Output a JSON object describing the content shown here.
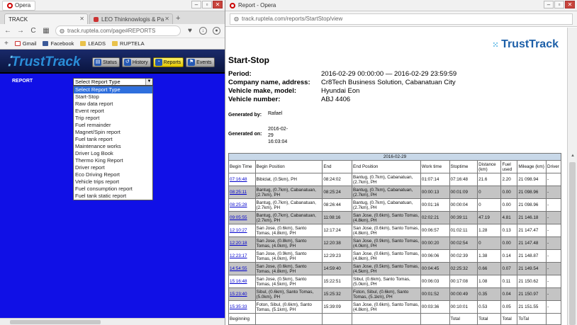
{
  "left": {
    "opera_label": "Opera",
    "tabs": [
      {
        "title": "TRACK"
      },
      {
        "title": "LEO Thinknowlogis & Pa"
      }
    ],
    "url": "track.ruptela.com/page#REPORTS",
    "bookmarks": [
      "Gmail",
      "Facebook",
      "LEADS",
      "RUPTELA"
    ],
    "app_logo": "TrustTrack",
    "nav": [
      "Status",
      "History",
      "Reports",
      "Events"
    ],
    "active_nav": "Reports",
    "report_label": "REPORT",
    "select_value": "Select Report Type",
    "options": [
      "Select Report Type",
      "Start-Stop",
      "Raw data report",
      "Event report",
      "Trip report",
      "Fuel remainder",
      "Magnet/Spin report",
      "Fuel tank report",
      "Maintenance works",
      "Driver Log Book",
      "Thermo King Report",
      "Driver report",
      "Eco Driving Report",
      "Vehicle trips report",
      "Fuel consumption report",
      "Fuel tank static report"
    ]
  },
  "right": {
    "window_title": "Report - Opera",
    "url": "track.ruptela.com/reports/StartStop/view",
    "logo": "TrustTrack",
    "report_title": "Start-Stop",
    "info": [
      {
        "k": "Period:",
        "v": "2016-02-29 00:00:00 — 2016-02-29 23:59:59"
      },
      {
        "k": "Company name, address:",
        "v": "Cr8Tech Business Solution, Cabanatuan City"
      },
      {
        "k": "Vehicle make, model:",
        "v": "Hyundai Eon"
      },
      {
        "k": "Vehicle number:",
        "v": "ABJ 4406"
      }
    ],
    "generated_by_label": "Generated by:",
    "generated_by": "Rafael",
    "generated_on_label": "Generated on:",
    "generated_on": [
      "2016-02-",
      "29",
      "16:03:04"
    ],
    "table": {
      "date": "2016-02-29",
      "headers": [
        "Begin Time",
        "Begin Position",
        "End",
        "End Position",
        "Work time",
        "Stoptime",
        "Distance (km)",
        "Fuel used",
        "Mileage (km)",
        "Driver"
      ],
      "rows": [
        [
          "07:16:48",
          "Bibiclat, (0.5km), PH",
          "08:24:02",
          "Bantug, (0.7km), Cabanatuan, (2.7km), PH",
          "01:07:14",
          "07:16:48",
          "21.6",
          "2.20",
          "21 098.94",
          "-"
        ],
        [
          "08:25:11",
          "Bantug, (0.7km), Cabanatuan, (2.7km), PH",
          "08:25:24",
          "Bantug, (0.7km), Cabanatuan, (2.7km), PH",
          "00:00:13",
          "00:01:09",
          "0",
          "0.00",
          "21 098.96",
          "-"
        ],
        [
          "08:25:28",
          "Bantug, (0.7km), Cabanatuan, (2.7km), PH",
          "08:26:44",
          "Bantug, (0.7km), Cabanatuan, (2.7km), PH",
          "00:01:16",
          "00:00:04",
          "0",
          "0.00",
          "21 098.96",
          "-"
        ],
        [
          "09:05:55",
          "Bantug, (0.7km), Cabanatuan, (2.7km), PH",
          "11:08:16",
          "San Jose, (0.6km), Santo Tomas, (4.8km), PH",
          "02:02:21",
          "00:39:11",
          "47.19",
          "4.81",
          "21 146.18",
          "-"
        ],
        [
          "12:10:27",
          "San Jose, (0.6km), Santo Tomas, (4.8km), PH",
          "12:17:24",
          "San Jose, (0.6km), Santo Tomas, (4.8km), PH",
          "00:06:57",
          "01:02:11",
          "1.28",
          "0.13",
          "21 147.47",
          "-"
        ],
        [
          "12:20:18",
          "San Jose, (0.8km), Santo Tomas, (4.0km), PH",
          "12:20:38",
          "San Jose, (0.9km), Santo Tomas, (4.0km), PH",
          "00:00:20",
          "00:02:54",
          "0",
          "0.00",
          "21 147.48",
          "-"
        ],
        [
          "12:23:17",
          "San Jose, (0.9km), Santo Tomas, (4.0km), PH",
          "12:29:23",
          "San Jose, (0.6km), Santo Tomas, (4.8km), PH",
          "00:06:06",
          "00:02:39",
          "1.38",
          "0.14",
          "21 148.87",
          "-"
        ],
        [
          "14:54:55",
          "San Jose, (0.6km), Santo Tomas, (4.8km), PH",
          "14:59:40",
          "San Jose, (0.5km), Santo Tomas, (4.5km), PH",
          "00:04:45",
          "02:25:32",
          "0.66",
          "0.07",
          "21 149.54",
          "-"
        ],
        [
          "15:16:48",
          "San Jose, (0.5km), Santo Tomas, (4.5km), PH",
          "15:22:51",
          "Sibul, (0.6km), Santo Tomas, (5.0km), PH",
          "00:06:03",
          "00:17:08",
          "1.08",
          "0.11",
          "21 150.62",
          "-"
        ],
        [
          "15:23:40",
          "Sibul, (0.6km), Santo Tomas, (5.0km), PH",
          "15:25:32",
          "Foton, Sibul, (0.6km), Santo Tomas, (5.1km), PH",
          "00:01:52",
          "00:00:49",
          "0.35",
          "0.04",
          "21 150.97",
          "-"
        ],
        [
          "15:35:33",
          "Foton, Sibul, (0.6km), Santo Tomas, (5.1km), PH",
          "15:39:09",
          "San Jose, (0.6km), Santo Tomas, (4.8km), PH",
          "00:03:36",
          "00:10:01",
          "0.53",
          "0.05",
          "21 151.55",
          "-"
        ]
      ],
      "total_row": [
        "Beginning",
        "",
        "",
        "",
        "",
        "Total",
        "Total",
        "Total",
        "ToTal",
        ""
      ]
    }
  }
}
